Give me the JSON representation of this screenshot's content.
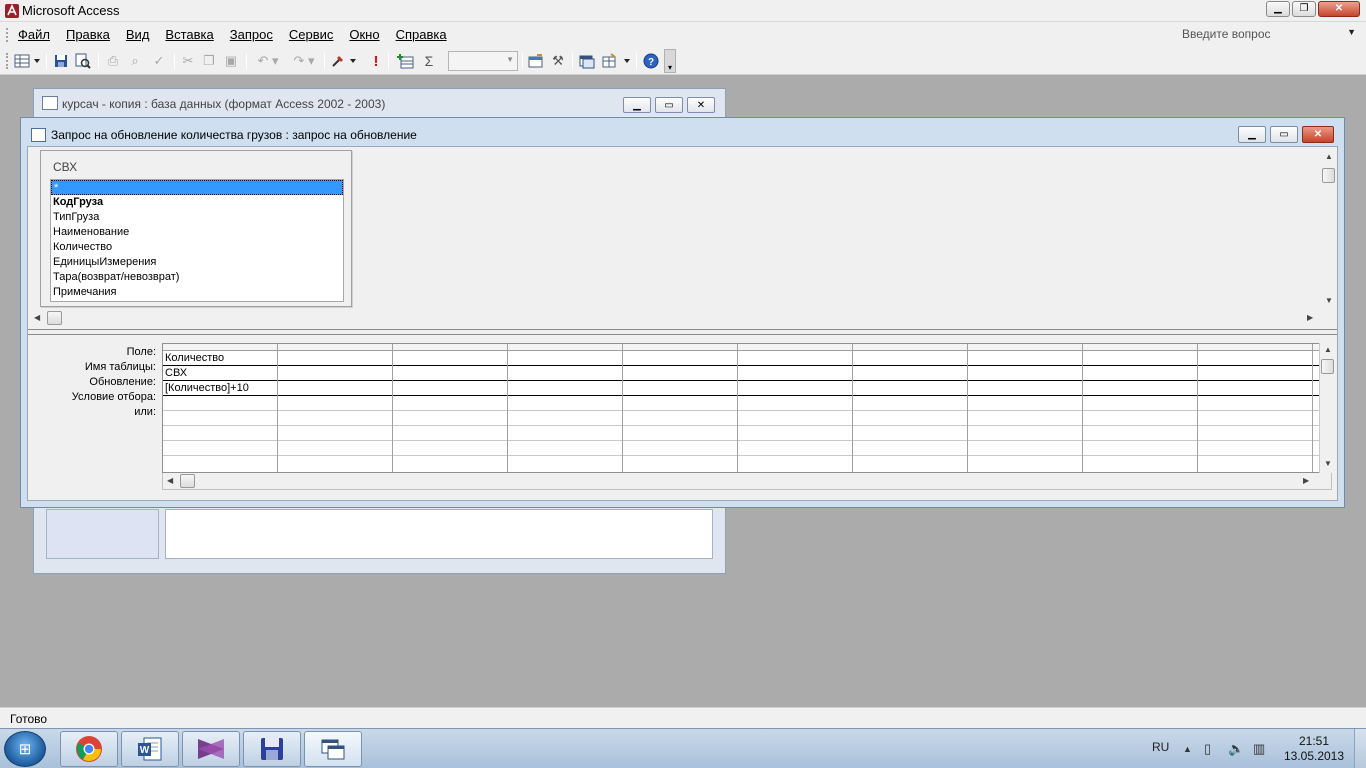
{
  "app": {
    "title": "Microsoft Access"
  },
  "menu": {
    "items": [
      "Файл",
      "Правка",
      "Вид",
      "Вставка",
      "Запрос",
      "Сервис",
      "Окно",
      "Справка"
    ],
    "ask_placeholder": "Введите вопрос"
  },
  "toolbar": {
    "icons": [
      "view-icon",
      "save-icon",
      "search-icon",
      "print-icon",
      "print-preview-icon",
      "spelling-icon",
      "cut-icon",
      "copy-icon",
      "paste-icon",
      "undo-icon",
      "redo-icon",
      "query-type-icon",
      "run-icon",
      "show-table-icon",
      "totals-icon",
      "top-values-icon",
      "properties-icon",
      "build-icon",
      "database-window-icon",
      "new-object-icon",
      "help-icon"
    ],
    "run_symbol": "!",
    "totals_symbol": "Σ"
  },
  "db_window": {
    "title": "курсач - копия : база данных (формат Access 2002 - 2003)"
  },
  "query_window": {
    "title": "Запрос на обновление количества грузов : запрос на обновление",
    "table": {
      "name": "СВХ",
      "fields": [
        "*",
        "КодГруза",
        "ТипГруза",
        "Наименование",
        "Количество",
        "ЕдиницыИзмерения",
        "Тара(возврат/невозврат)",
        "Примечания"
      ]
    },
    "grid": {
      "row_labels": [
        "Поле:",
        "Имя таблицы:",
        "Обновление:",
        "Условие отбора:",
        "или:"
      ],
      "columns": [
        {
          "field": "Количество",
          "table": "СВХ",
          "update": "[Количество]+10"
        }
      ]
    }
  },
  "status": {
    "text": "Готово"
  },
  "taskbar": {
    "apps": [
      "chrome-icon",
      "word-icon",
      "visual-studio-icon",
      "save-disk-icon",
      "access-window-icon"
    ],
    "language": "RU",
    "time": "21:51",
    "date": "13.05.2013"
  },
  "colors": {
    "selection": "#3399ff",
    "window_frame": "#cfdff0",
    "close_button": "#c8432a",
    "desktop": "#ababab"
  }
}
